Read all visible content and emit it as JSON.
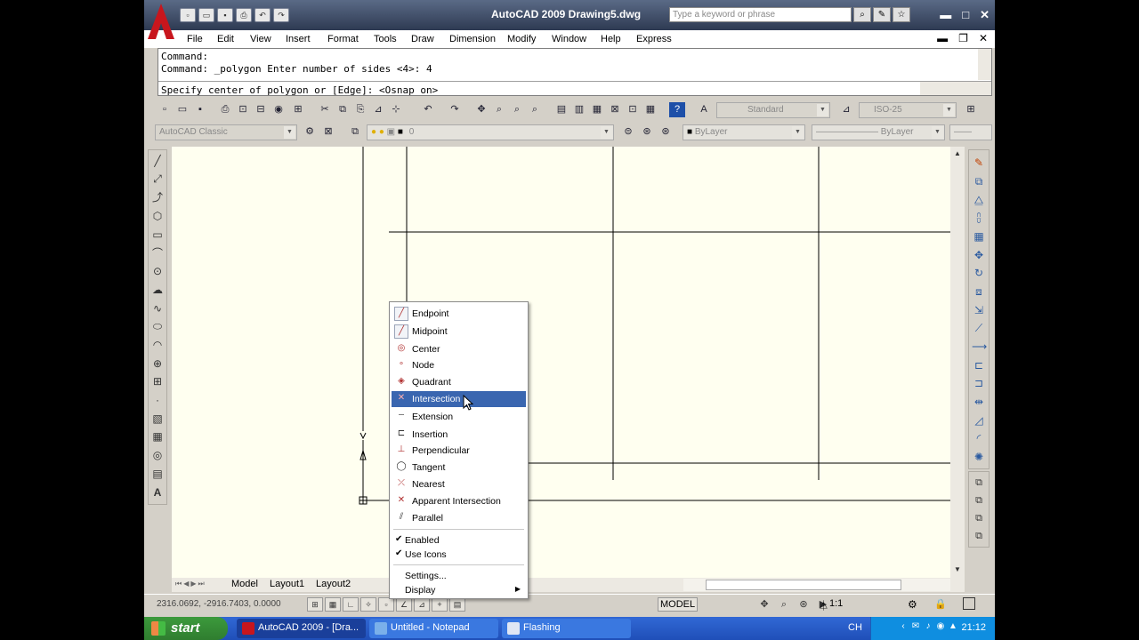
{
  "window": {
    "title": "AutoCAD 2009  Drawing5.dwg",
    "search_placeholder": "Type a keyword or phrase",
    "minimize": "▬",
    "restore": "□",
    "close": "✕"
  },
  "quick_access": [
    "new-icon",
    "open-icon",
    "save-icon",
    "print-icon",
    "undo-icon",
    "redo-icon"
  ],
  "menubar": {
    "items": [
      "File",
      "Edit",
      "View",
      "Insert",
      "Format",
      "Tools",
      "Draw",
      "Dimension",
      "Modify",
      "Window",
      "Help",
      "Express"
    ]
  },
  "command": {
    "line1": "Command:",
    "line2": "Command: _polygon Enter number of sides <4>: 4",
    "line3": "Specify center of polygon or [Edge]:  <Osnap on>"
  },
  "toolbars": {
    "workspace": "AutoCAD Classic",
    "text_style": "Standard",
    "dim_style": "ISO-25",
    "layer": "0",
    "color": "ByLayer",
    "linetype": "ByLayer"
  },
  "tabs": {
    "items": [
      "Model",
      "Layout1",
      "Layout2"
    ],
    "active": "Model"
  },
  "status": {
    "coordinates": "2316.0692, -2916.7403, 0.0000",
    "model_label": "MODEL",
    "annotation_scale": "1:1"
  },
  "osnap_menu": {
    "items": [
      {
        "label": "Endpoint",
        "icon": "endpoint-icon"
      },
      {
        "label": "Midpoint",
        "icon": "midpoint-icon"
      },
      {
        "label": "Center",
        "icon": "center-icon"
      },
      {
        "label": "Node",
        "icon": "node-icon"
      },
      {
        "label": "Quadrant",
        "icon": "quadrant-icon"
      },
      {
        "label": "Intersection",
        "icon": "intersection-icon",
        "highlighted": true
      },
      {
        "label": "Extension",
        "icon": "extension-icon"
      },
      {
        "label": "Insertion",
        "icon": "insertion-icon"
      },
      {
        "label": "Perpendicular",
        "icon": "perpendicular-icon"
      },
      {
        "label": "Tangent",
        "icon": "tangent-icon"
      },
      {
        "label": "Nearest",
        "icon": "nearest-icon"
      },
      {
        "label": "Apparent Intersection",
        "icon": "apparent-intersection-icon"
      },
      {
        "label": "Parallel",
        "icon": "parallel-icon"
      }
    ],
    "enabled_label": "Enabled",
    "use_icons_label": "Use Icons",
    "settings_label": "Settings...",
    "display_label": "Display"
  },
  "taskbar": {
    "start": "start",
    "tasks": [
      {
        "label": "AutoCAD 2009 - [Dra...",
        "active": true
      },
      {
        "label": "Untitled - Notepad",
        "active": false
      },
      {
        "label": "Flashing",
        "active": false
      }
    ],
    "lang": "CH",
    "clock": "21:12"
  },
  "colors": {
    "title_bar": "#2e3a52",
    "canvas_bg": "#fffff0",
    "menu_highlight": "#3a66b0",
    "taskbar": "#2456c8",
    "start_button": "#2f7d2f"
  }
}
